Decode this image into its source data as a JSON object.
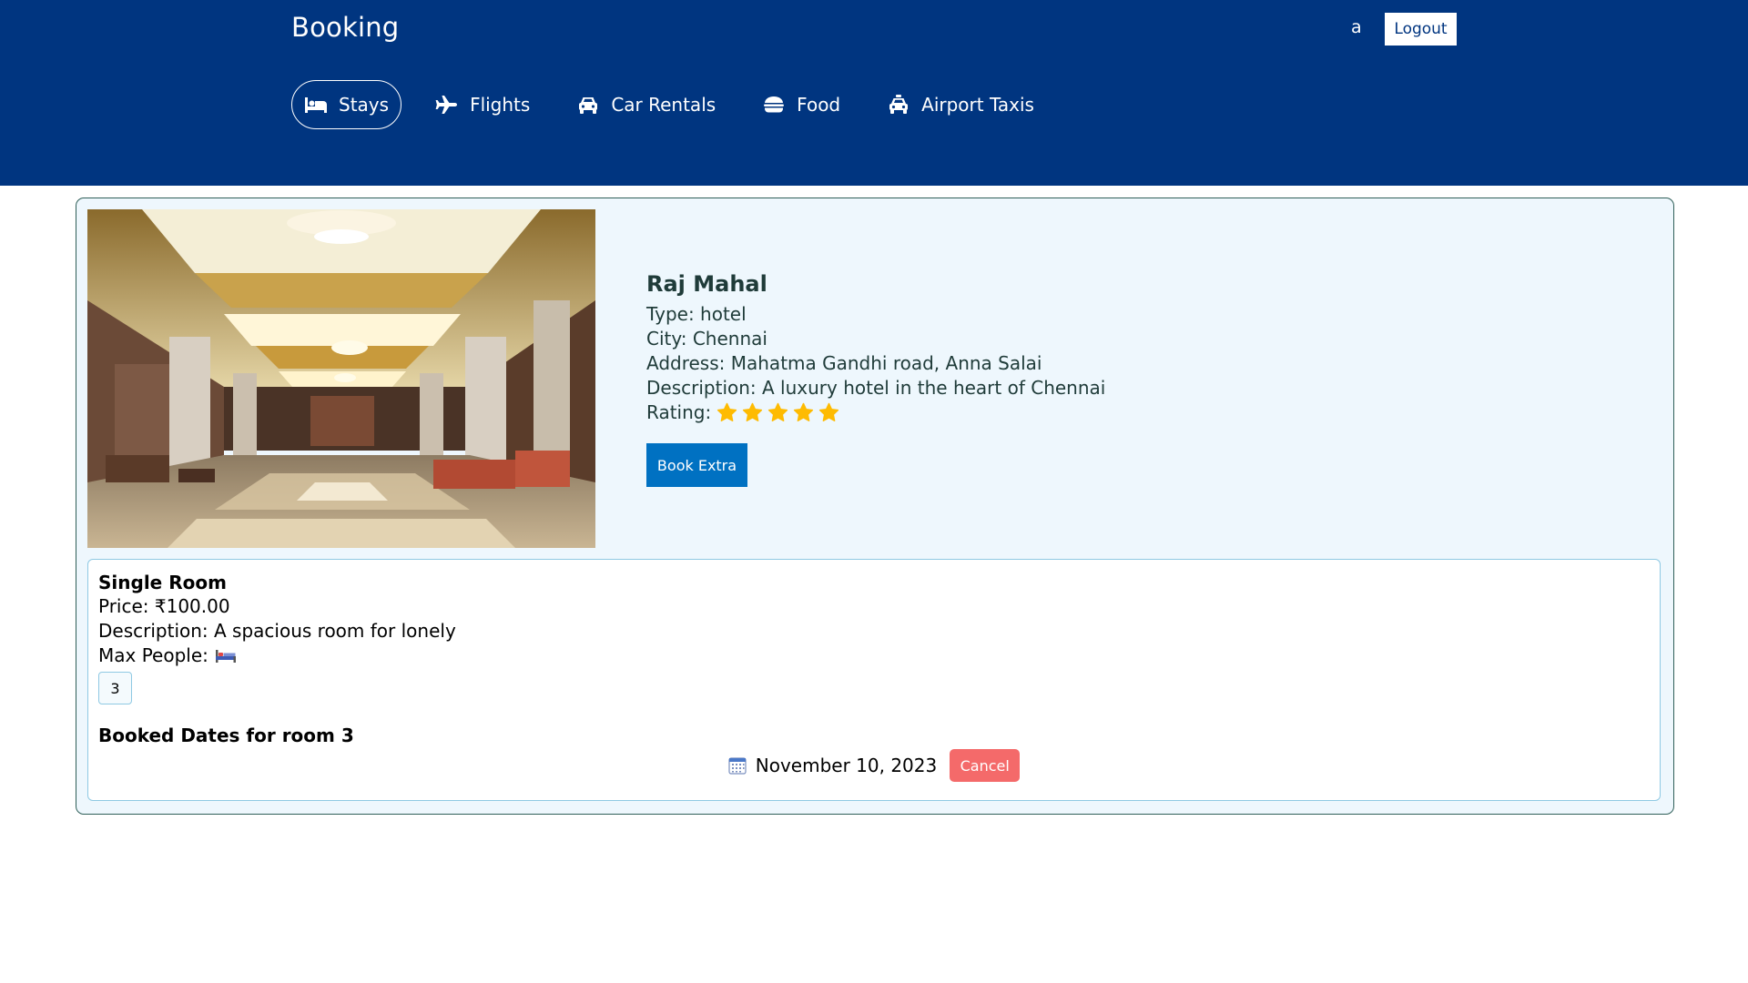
{
  "header": {
    "brand": "Booking",
    "user": "a",
    "logout_label": "Logout"
  },
  "nav": {
    "items": [
      {
        "label": "Stays",
        "icon": "bed-icon",
        "active": true
      },
      {
        "label": "Flights",
        "icon": "plane-icon"
      },
      {
        "label": "Car Rentals",
        "icon": "car-icon"
      },
      {
        "label": "Food",
        "icon": "food-icon"
      },
      {
        "label": "Airport Taxis",
        "icon": "taxi-icon"
      }
    ]
  },
  "hotel": {
    "name": "Raj Mahal",
    "type_line": "Type: hotel",
    "city_line": "City: Chennai",
    "address_line": "Address: Mahatma Gandhi road, Anna Salai",
    "description_line": "Description: A luxury hotel in the heart of Chennai",
    "rating_label": "Rating:",
    "rating": 5,
    "book_extra_label": "Book Extra",
    "photo": "hotel-lobby-photo"
  },
  "room": {
    "title": "Single Room",
    "price_line": "Price: ₹100.00",
    "description_line": "Description: A spacious room for lonely",
    "max_people_label": "Max People:",
    "room_number": "3",
    "booked_title": "Booked Dates for room 3",
    "booked_date": "November 10, 2023",
    "cancel_label": "Cancel"
  },
  "colors": {
    "header_bg": "#003580",
    "primary_button": "#0071c2",
    "cancel_button": "#f46a6a",
    "card_bg": "#eef7fd",
    "star": "#febb02"
  }
}
